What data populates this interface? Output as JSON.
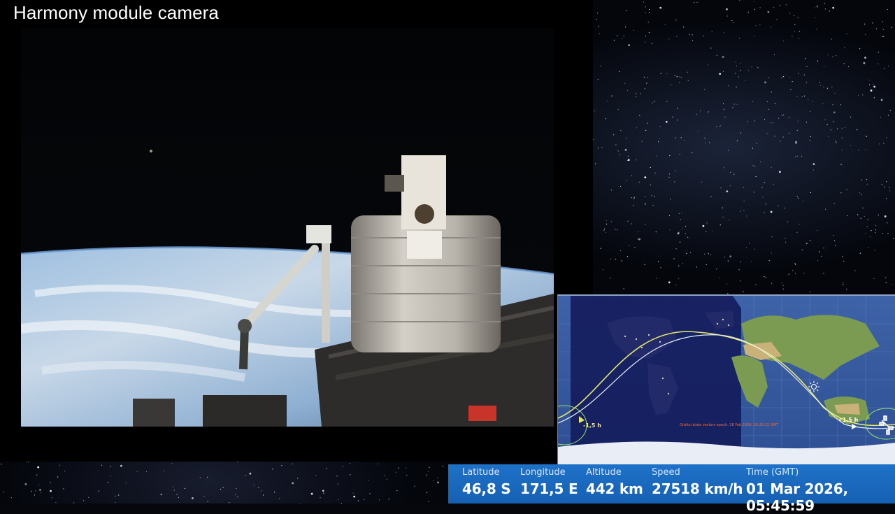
{
  "camera": {
    "title": "Harmony module camera"
  },
  "map": {
    "label_minus": "-1,5 h",
    "label_plus": "+1,5 h",
    "note": "Orbital state vectors epoch: 28 Feb 2026, 02:29:32 GMT"
  },
  "telemetry": {
    "latitude": {
      "label": "Latitude",
      "value": "46,8 S"
    },
    "longitude": {
      "label": "Longitude",
      "value": "171,5 E"
    },
    "altitude": {
      "label": "Altitude",
      "value": "442 km"
    },
    "speed": {
      "label": "Speed",
      "value": "27518 km/h"
    },
    "time": {
      "label": "Time (GMT)",
      "value": "01 Mar 2026, 05:45:59"
    }
  },
  "colors": {
    "telemetry_bar": "#1a68bd",
    "ground_track_past": "#e4e86a",
    "ground_track_future": "#e9eef5"
  }
}
